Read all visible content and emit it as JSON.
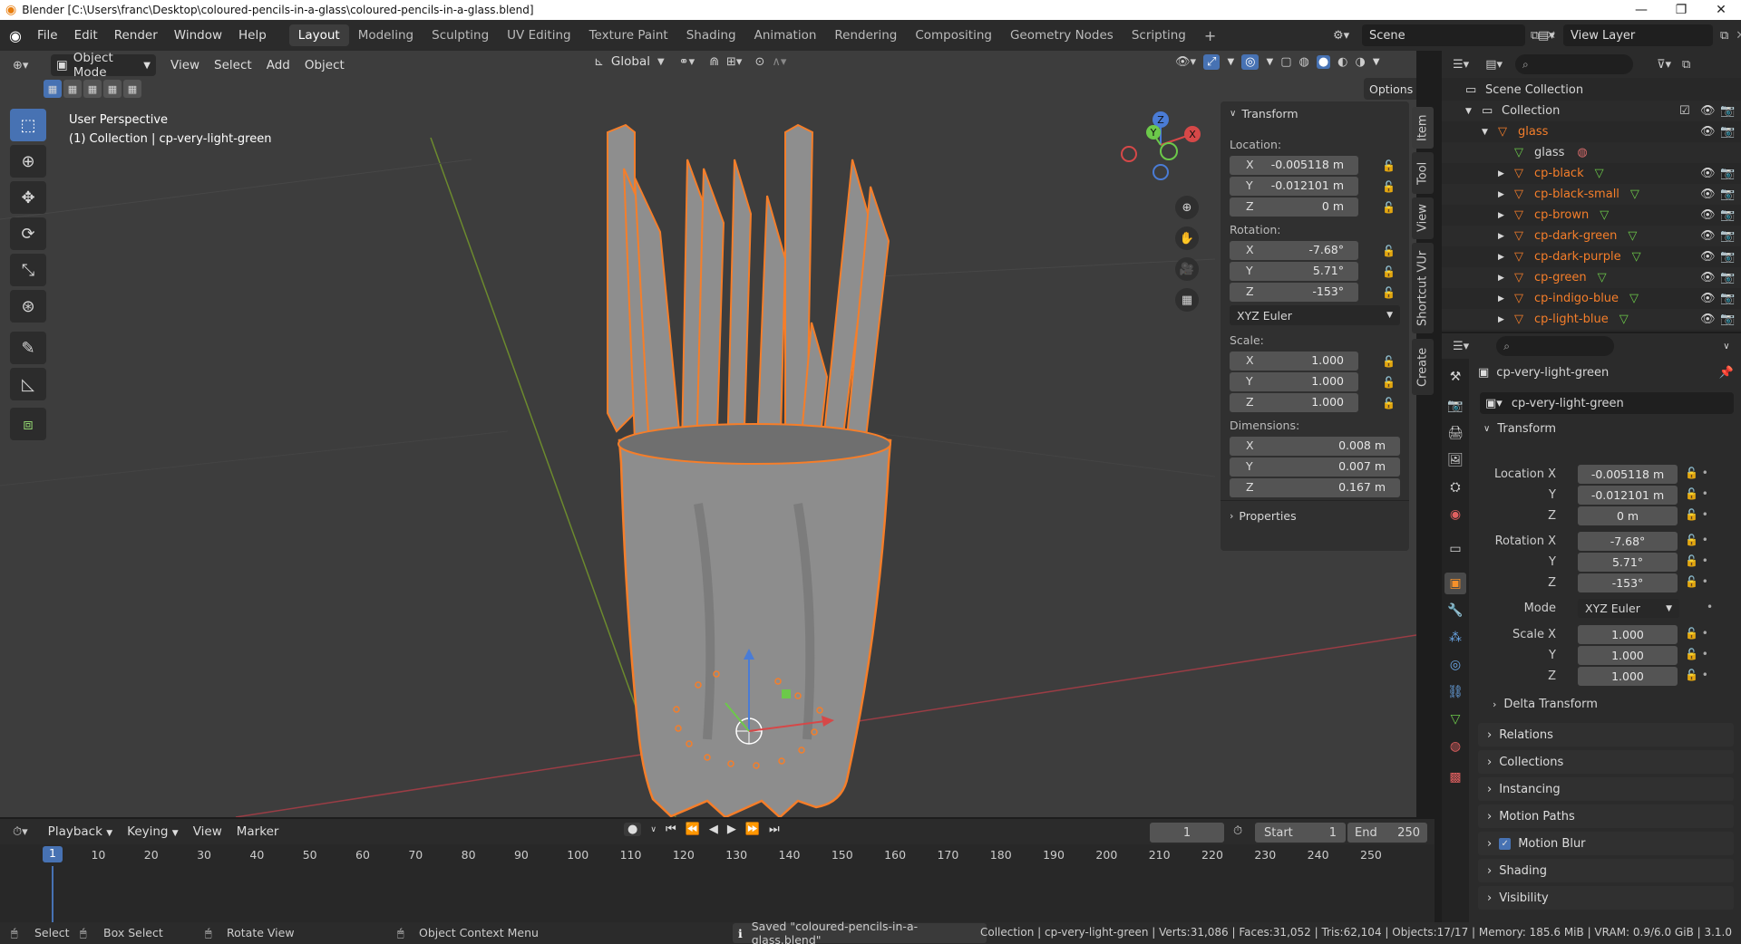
{
  "titlebar": {
    "title": "Blender [C:\\Users\\franc\\Desktop\\coloured-pencils-in-a-glass\\coloured-pencils-in-a-glass.blend]",
    "minimize": "—",
    "maximize": "❐",
    "close": "✕"
  },
  "menubar": {
    "items": [
      "File",
      "Edit",
      "Render",
      "Window",
      "Help"
    ],
    "workspaces": [
      "Layout",
      "Modeling",
      "Sculpting",
      "UV Editing",
      "Texture Paint",
      "Shading",
      "Animation",
      "Rendering",
      "Compositing",
      "Geometry Nodes",
      "Scripting"
    ],
    "active_workspace": "Layout",
    "add_tab": "+",
    "scene": "Scene",
    "view_layer": "View Layer"
  },
  "viewport": {
    "mode": "Object Mode",
    "menus": [
      "View",
      "Select",
      "Add",
      "Object"
    ],
    "orientation": "Global",
    "options": "Options",
    "overlay_title": "User Perspective",
    "overlay_subtitle": "(1) Collection | cp-very-light-green",
    "gizmo_axes": {
      "x": "X",
      "y": "Y",
      "z": "Z"
    }
  },
  "npanel": {
    "header": "Transform",
    "location_label": "Location:",
    "location": [
      {
        "axis": "X",
        "value": "-0.005118 m"
      },
      {
        "axis": "Y",
        "value": "-0.012101 m"
      },
      {
        "axis": "Z",
        "value": "0 m"
      }
    ],
    "rotation_label": "Rotation:",
    "rotation": [
      {
        "axis": "X",
        "value": "-7.68°"
      },
      {
        "axis": "Y",
        "value": "5.71°"
      },
      {
        "axis": "Z",
        "value": "-153°"
      }
    ],
    "rotation_mode": "XYZ Euler",
    "scale_label": "Scale:",
    "scale": [
      {
        "axis": "X",
        "value": "1.000"
      },
      {
        "axis": "Y",
        "value": "1.000"
      },
      {
        "axis": "Z",
        "value": "1.000"
      }
    ],
    "dimensions_label": "Dimensions:",
    "dimensions": [
      {
        "axis": "X",
        "value": "0.008 m"
      },
      {
        "axis": "Y",
        "value": "0.007 m"
      },
      {
        "axis": "Z",
        "value": "0.167 m"
      }
    ],
    "properties": "Properties",
    "tabs": [
      "Item",
      "Tool",
      "View",
      "Shortcut VUr",
      "Create"
    ]
  },
  "outliner": {
    "rows": [
      {
        "label": "Scene Collection",
        "indent": 0,
        "kind": "scene"
      },
      {
        "label": "Collection",
        "indent": 1,
        "kind": "collection"
      },
      {
        "label": "glass",
        "indent": 2,
        "kind": "object-selected"
      },
      {
        "label": "glass",
        "indent": 3,
        "kind": "mesh"
      },
      {
        "label": "cp-black",
        "indent": 3,
        "kind": "object"
      },
      {
        "label": "cp-black-small",
        "indent": 3,
        "kind": "object"
      },
      {
        "label": "cp-brown",
        "indent": 3,
        "kind": "object"
      },
      {
        "label": "cp-dark-green",
        "indent": 3,
        "kind": "object"
      },
      {
        "label": "cp-dark-purple",
        "indent": 3,
        "kind": "object"
      },
      {
        "label": "cp-green",
        "indent": 3,
        "kind": "object"
      },
      {
        "label": "cp-indigo-blue",
        "indent": 3,
        "kind": "object"
      },
      {
        "label": "cp-light-blue",
        "indent": 3,
        "kind": "object"
      }
    ]
  },
  "properties": {
    "object_name": "cp-very-light-green",
    "name_field": "cp-very-light-green",
    "transform_header": "Transform",
    "location_label": "Location X",
    "location": [
      "-0.005118 m",
      "-0.012101 m",
      "0 m"
    ],
    "rotation_label": "Rotation X",
    "rotation": [
      "-7.68°",
      "5.71°",
      "-153°"
    ],
    "mode_label": "Mode",
    "mode": "XYZ Euler",
    "scale_label": "Scale X",
    "scale": [
      "1.000",
      "1.000",
      "1.000"
    ],
    "y_label": "Y",
    "z_label": "Z",
    "delta_transform": "Delta Transform",
    "sections": [
      "Relations",
      "Collections",
      "Instancing",
      "Motion Paths",
      "Motion Blur",
      "Shading",
      "Visibility"
    ]
  },
  "timeline": {
    "menus": [
      "Playback",
      "Keying",
      "View",
      "Marker"
    ],
    "current_frame": "1",
    "start_label": "Start",
    "start": "1",
    "end_label": "End",
    "end": "250",
    "ticks": [
      "1",
      "10",
      "20",
      "30",
      "40",
      "50",
      "60",
      "70",
      "80",
      "90",
      "100",
      "110",
      "120",
      "130",
      "140",
      "150",
      "160",
      "170",
      "180",
      "190",
      "200",
      "210",
      "220",
      "230",
      "240",
      "250"
    ]
  },
  "statusbar": {
    "select": "Select",
    "box_select": "Box Select",
    "rotate_view": "Rotate View",
    "context_menu": "Object Context Menu",
    "message": "Saved \"coloured-pencils-in-a-glass.blend\"",
    "stats": "Collection | cp-very-light-green | Verts:31,086 | Faces:31,052 | Tris:62,104 | Objects:17/17 | Memory: 185.6 MiB | VRAM: 0.9/6.0 GiB | 3.1.0"
  },
  "colors": {
    "accent": "#4772b3",
    "selection_orange": "#f57e2a",
    "active_orange": "#ffa94d",
    "mesh_green": "#6cc94a"
  }
}
